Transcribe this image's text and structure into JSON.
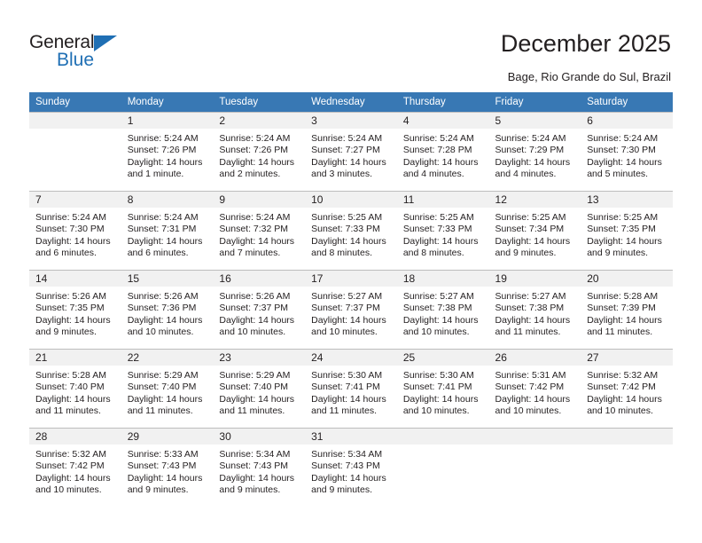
{
  "brand": {
    "name_part1": "General",
    "name_part2": "Blue",
    "triangle_color": "#1f6fb4"
  },
  "header": {
    "title": "December 2025",
    "subtitle": "Bage, Rio Grande do Sul, Brazil",
    "accent_color": "#3878b4"
  },
  "weekdays": [
    "Sunday",
    "Monday",
    "Tuesday",
    "Wednesday",
    "Thursday",
    "Friday",
    "Saturday"
  ],
  "weeks": [
    [
      {
        "day": "",
        "sunrise": "",
        "sunset": "",
        "daylight1": "",
        "daylight2": ""
      },
      {
        "day": "1",
        "sunrise": "Sunrise: 5:24 AM",
        "sunset": "Sunset: 7:26 PM",
        "daylight1": "Daylight: 14 hours",
        "daylight2": "and 1 minute."
      },
      {
        "day": "2",
        "sunrise": "Sunrise: 5:24 AM",
        "sunset": "Sunset: 7:26 PM",
        "daylight1": "Daylight: 14 hours",
        "daylight2": "and 2 minutes."
      },
      {
        "day": "3",
        "sunrise": "Sunrise: 5:24 AM",
        "sunset": "Sunset: 7:27 PM",
        "daylight1": "Daylight: 14 hours",
        "daylight2": "and 3 minutes."
      },
      {
        "day": "4",
        "sunrise": "Sunrise: 5:24 AM",
        "sunset": "Sunset: 7:28 PM",
        "daylight1": "Daylight: 14 hours",
        "daylight2": "and 4 minutes."
      },
      {
        "day": "5",
        "sunrise": "Sunrise: 5:24 AM",
        "sunset": "Sunset: 7:29 PM",
        "daylight1": "Daylight: 14 hours",
        "daylight2": "and 4 minutes."
      },
      {
        "day": "6",
        "sunrise": "Sunrise: 5:24 AM",
        "sunset": "Sunset: 7:30 PM",
        "daylight1": "Daylight: 14 hours",
        "daylight2": "and 5 minutes."
      }
    ],
    [
      {
        "day": "7",
        "sunrise": "Sunrise: 5:24 AM",
        "sunset": "Sunset: 7:30 PM",
        "daylight1": "Daylight: 14 hours",
        "daylight2": "and 6 minutes."
      },
      {
        "day": "8",
        "sunrise": "Sunrise: 5:24 AM",
        "sunset": "Sunset: 7:31 PM",
        "daylight1": "Daylight: 14 hours",
        "daylight2": "and 6 minutes."
      },
      {
        "day": "9",
        "sunrise": "Sunrise: 5:24 AM",
        "sunset": "Sunset: 7:32 PM",
        "daylight1": "Daylight: 14 hours",
        "daylight2": "and 7 minutes."
      },
      {
        "day": "10",
        "sunrise": "Sunrise: 5:25 AM",
        "sunset": "Sunset: 7:33 PM",
        "daylight1": "Daylight: 14 hours",
        "daylight2": "and 8 minutes."
      },
      {
        "day": "11",
        "sunrise": "Sunrise: 5:25 AM",
        "sunset": "Sunset: 7:33 PM",
        "daylight1": "Daylight: 14 hours",
        "daylight2": "and 8 minutes."
      },
      {
        "day": "12",
        "sunrise": "Sunrise: 5:25 AM",
        "sunset": "Sunset: 7:34 PM",
        "daylight1": "Daylight: 14 hours",
        "daylight2": "and 9 minutes."
      },
      {
        "day": "13",
        "sunrise": "Sunrise: 5:25 AM",
        "sunset": "Sunset: 7:35 PM",
        "daylight1": "Daylight: 14 hours",
        "daylight2": "and 9 minutes."
      }
    ],
    [
      {
        "day": "14",
        "sunrise": "Sunrise: 5:26 AM",
        "sunset": "Sunset: 7:35 PM",
        "daylight1": "Daylight: 14 hours",
        "daylight2": "and 9 minutes."
      },
      {
        "day": "15",
        "sunrise": "Sunrise: 5:26 AM",
        "sunset": "Sunset: 7:36 PM",
        "daylight1": "Daylight: 14 hours",
        "daylight2": "and 10 minutes."
      },
      {
        "day": "16",
        "sunrise": "Sunrise: 5:26 AM",
        "sunset": "Sunset: 7:37 PM",
        "daylight1": "Daylight: 14 hours",
        "daylight2": "and 10 minutes."
      },
      {
        "day": "17",
        "sunrise": "Sunrise: 5:27 AM",
        "sunset": "Sunset: 7:37 PM",
        "daylight1": "Daylight: 14 hours",
        "daylight2": "and 10 minutes."
      },
      {
        "day": "18",
        "sunrise": "Sunrise: 5:27 AM",
        "sunset": "Sunset: 7:38 PM",
        "daylight1": "Daylight: 14 hours",
        "daylight2": "and 10 minutes."
      },
      {
        "day": "19",
        "sunrise": "Sunrise: 5:27 AM",
        "sunset": "Sunset: 7:38 PM",
        "daylight1": "Daylight: 14 hours",
        "daylight2": "and 11 minutes."
      },
      {
        "day": "20",
        "sunrise": "Sunrise: 5:28 AM",
        "sunset": "Sunset: 7:39 PM",
        "daylight1": "Daylight: 14 hours",
        "daylight2": "and 11 minutes."
      }
    ],
    [
      {
        "day": "21",
        "sunrise": "Sunrise: 5:28 AM",
        "sunset": "Sunset: 7:40 PM",
        "daylight1": "Daylight: 14 hours",
        "daylight2": "and 11 minutes."
      },
      {
        "day": "22",
        "sunrise": "Sunrise: 5:29 AM",
        "sunset": "Sunset: 7:40 PM",
        "daylight1": "Daylight: 14 hours",
        "daylight2": "and 11 minutes."
      },
      {
        "day": "23",
        "sunrise": "Sunrise: 5:29 AM",
        "sunset": "Sunset: 7:40 PM",
        "daylight1": "Daylight: 14 hours",
        "daylight2": "and 11 minutes."
      },
      {
        "day": "24",
        "sunrise": "Sunrise: 5:30 AM",
        "sunset": "Sunset: 7:41 PM",
        "daylight1": "Daylight: 14 hours",
        "daylight2": "and 11 minutes."
      },
      {
        "day": "25",
        "sunrise": "Sunrise: 5:30 AM",
        "sunset": "Sunset: 7:41 PM",
        "daylight1": "Daylight: 14 hours",
        "daylight2": "and 10 minutes."
      },
      {
        "day": "26",
        "sunrise": "Sunrise: 5:31 AM",
        "sunset": "Sunset: 7:42 PM",
        "daylight1": "Daylight: 14 hours",
        "daylight2": "and 10 minutes."
      },
      {
        "day": "27",
        "sunrise": "Sunrise: 5:32 AM",
        "sunset": "Sunset: 7:42 PM",
        "daylight1": "Daylight: 14 hours",
        "daylight2": "and 10 minutes."
      }
    ],
    [
      {
        "day": "28",
        "sunrise": "Sunrise: 5:32 AM",
        "sunset": "Sunset: 7:42 PM",
        "daylight1": "Daylight: 14 hours",
        "daylight2": "and 10 minutes."
      },
      {
        "day": "29",
        "sunrise": "Sunrise: 5:33 AM",
        "sunset": "Sunset: 7:43 PM",
        "daylight1": "Daylight: 14 hours",
        "daylight2": "and 9 minutes."
      },
      {
        "day": "30",
        "sunrise": "Sunrise: 5:34 AM",
        "sunset": "Sunset: 7:43 PM",
        "daylight1": "Daylight: 14 hours",
        "daylight2": "and 9 minutes."
      },
      {
        "day": "31",
        "sunrise": "Sunrise: 5:34 AM",
        "sunset": "Sunset: 7:43 PM",
        "daylight1": "Daylight: 14 hours",
        "daylight2": "and 9 minutes."
      },
      {
        "day": "",
        "sunrise": "",
        "sunset": "",
        "daylight1": "",
        "daylight2": ""
      },
      {
        "day": "",
        "sunrise": "",
        "sunset": "",
        "daylight1": "",
        "daylight2": ""
      },
      {
        "day": "",
        "sunrise": "",
        "sunset": "",
        "daylight1": "",
        "daylight2": ""
      }
    ]
  ]
}
